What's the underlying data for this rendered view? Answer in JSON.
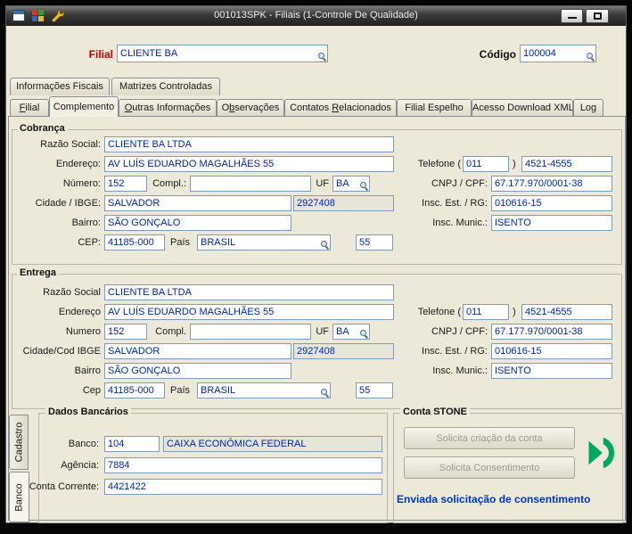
{
  "colors": {
    "field_text": "#0026b8",
    "filial_label_red": "#cc0000",
    "stone_green": "#00a859",
    "status_blue": "#0033cc"
  },
  "titlebar": {
    "title": "001013SPK - Filiais (1-Controle De Qualidade)",
    "icons": [
      "form-icon",
      "records-grid-icon",
      "wrench-icon"
    ],
    "minimize_glyph": "",
    "maximize_glyph": ""
  },
  "header": {
    "filial_label": "Filial",
    "filial_value": "CLIENTE BA",
    "codigo_label": "Código",
    "codigo_value": "100004"
  },
  "outer_tabs": [
    {
      "label": "Informações Fiscais"
    },
    {
      "label": "Matrizes Controladas"
    }
  ],
  "main_tabs": [
    {
      "label": "Filial"
    },
    {
      "label": "Complemento"
    },
    {
      "label": "Outras Informações"
    },
    {
      "label": "Observações"
    },
    {
      "label": "Contatos Relacionados"
    },
    {
      "label": "Filial Espelho"
    },
    {
      "label": "Acesso Download XML"
    },
    {
      "label": "Log"
    }
  ],
  "active_main_tab": "Complemento",
  "cobranca": {
    "title": "Cobrança",
    "razao_social_label": "Razão Social:",
    "razao_social_value": "CLIENTE BA LTDA",
    "endereco_label": "Endereço:",
    "endereco_value": "AV LUÍS EDUARDO MAGALHÃES 55",
    "telefone_label": "Telefone (",
    "telefone_ddd": "011",
    "telefone_close": ")",
    "telefone_numero": "4521-4555",
    "numero_label": "Número:",
    "numero_value": "152",
    "compl_label": "Compl.:",
    "compl_value": "",
    "uf_label": "UF",
    "uf_value": "BA",
    "cnpj_label": "CNPJ / CPF:",
    "cnpj_value": "67.177.970/0001-38",
    "cidade_label": "Cidade / IBGE:",
    "cidade_value": "SALVADOR",
    "ibge_value": "2927408",
    "insc_est_label": "Insc. Est. / RG:",
    "insc_est_value": "010616-15",
    "bairro_label": "Bairro:",
    "bairro_value": "SÃO GONÇALO",
    "insc_mun_label": "Insc. Munic.:",
    "insc_mun_value": "ISENTO",
    "cep_label": "CEP:",
    "cep_value": "41185-000",
    "pais_label": "País",
    "pais_value": "BRASIL",
    "pais_codigo": "55"
  },
  "entrega": {
    "title": "Entrega",
    "razao_social_label": "Razão Social",
    "razao_social_value": "CLIENTE BA LTDA",
    "endereco_label": "Endereço",
    "endereco_value": "AV LUÍS EDUARDO MAGALHÃES 55",
    "telefone_label": "Telefone (",
    "telefone_ddd": "011",
    "telefone_close": ")",
    "telefone_numero": "4521-4555",
    "numero_label": "Numero",
    "numero_value": "152",
    "compl_label": "Compl.",
    "compl_value": "",
    "uf_label": "UF",
    "uf_value": "BA",
    "cnpj_label": "CNPJ / CPF:",
    "cnpj_value": "67.177.970/0001-38",
    "cidade_label": "Cidade/Cod IBGE",
    "cidade_value": "SALVADOR",
    "ibge_value": "2927408",
    "insc_est_label": "Insc. Est. / RG:",
    "insc_est_value": "010616-15",
    "bairro_label": "Bairro",
    "bairro_value": "SÃO GONÇALO",
    "insc_mun_label": "Insc. Munic.:",
    "insc_mun_value": "ISENTO",
    "cep_label": "Cep",
    "cep_value": "41185-000",
    "pais_label": "País",
    "pais_value": "BRASIL",
    "pais_codigo": "55"
  },
  "side_tabs": [
    {
      "label": "Cadastro"
    },
    {
      "label": "Banco"
    }
  ],
  "active_side_tab": "Banco",
  "dados_bancarios": {
    "title": "Dados Bancários",
    "banco_label": "Banco:",
    "banco_codigo": "104",
    "banco_nome": "CAIXA ECONÔMICA FEDERAL",
    "agencia_label": "Agência:",
    "agencia_value": "7884",
    "conta_label": "Conta Corrente:",
    "conta_value": "4421422"
  },
  "conta_stone": {
    "title": "Conta STONE",
    "botao_criacao": "Solicita criação da conta",
    "botao_consentimento": "Solicita Consentimento",
    "status": "Enviada solicitação de consentimento"
  }
}
